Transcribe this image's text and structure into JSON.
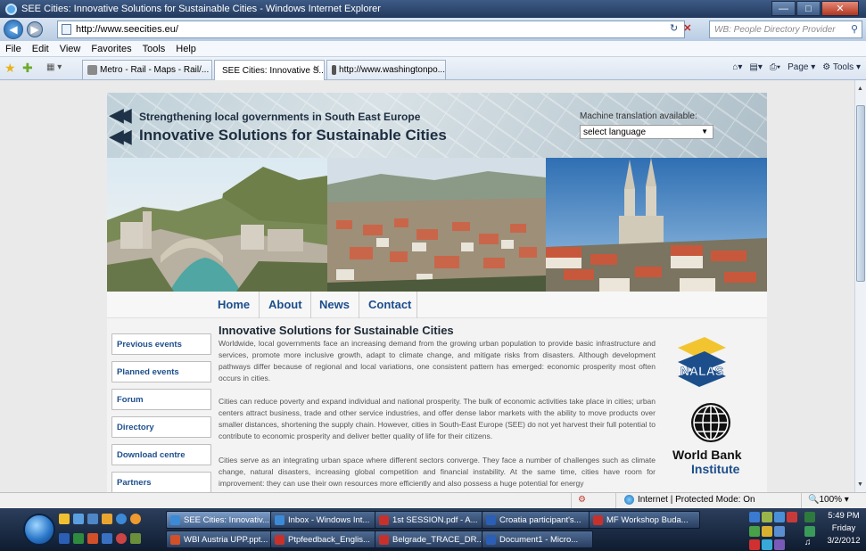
{
  "window": {
    "title": "SEE Cities: Innovative Solutions for Sustainable Cities - Windows Internet Explorer",
    "controls": [
      "minimize",
      "maximize",
      "close"
    ]
  },
  "address_bar": {
    "url": "http://www.seecities.eu/",
    "search_placeholder": "WB: People Directory Provider"
  },
  "menu": [
    "File",
    "Edit",
    "View",
    "Favorites",
    "Tools",
    "Help"
  ],
  "tabs": [
    {
      "label": "Metro - Rail - Maps - Rail/...",
      "icon": "metro-icon",
      "color": "#8a8a8a"
    },
    {
      "label": "SEE Cities: Innovative S...",
      "icon": "ie-icon",
      "color": "#3c8ad6",
      "active": true
    },
    {
      "label": "http://www.washingtonpo...",
      "icon": "washington-post-icon",
      "color": "#555555"
    }
  ],
  "command_bar": [
    "Page",
    "Tools"
  ],
  "site": {
    "banner_line1": "Strengthening local governments in South East Europe",
    "banner_line2": "Innovative Solutions for Sustainable Cities",
    "translation_label": "Machine translation available:",
    "language_select": "select language",
    "nav": [
      "Home",
      "About",
      "News",
      "Contact"
    ],
    "sidebar": [
      "Previous events",
      "Planned events",
      "Forum",
      "Directory",
      "Download centre",
      "Partners"
    ],
    "content_title": "Innovative Solutions for Sustainable Cities",
    "paragraphs": [
      "Worldwide, local governments face an increasing demand from the growing urban population to provide basic infrastructure and services, promote more inclusive growth, adapt to climate change, and mitigate risks from disasters. Although development pathways differ because of regional and local variations, one consistent pattern has emerged: economic prosperity most often occurs in cities.",
      "Cities can reduce poverty and expand individual and national prosperity. The bulk of economic activities take place in cities; urban centers attract business, trade and other service industries, and offer dense labor markets with the ability to move products over smaller distances, shortening the supply chain. However, cities in South-East Europe (SEE) do not yet harvest their full potential to contribute to economic prosperity and deliver better quality of life for their citizens.",
      "Cities serve as an integrating urban space where different sectors converge. They face a number of challenges such as climate change, natural disasters, increasing global competition and financial instability. At the same time, cities have room for improvement: they can use their own resources more efficiently and also possess a huge potential for energy"
    ],
    "partner_logos": {
      "nalas": "NALAS",
      "world_bank_line1": "World Bank",
      "world_bank_line2": "Institute"
    }
  },
  "status_bar": {
    "zone": "Internet | Protected Mode: On",
    "zoom": "100%"
  },
  "taskbar": {
    "row1": [
      {
        "label": "SEE Cities: Innovativ...",
        "color": "#3c8ad6",
        "active": true
      },
      {
        "label": "Inbox - Windows Int...",
        "color": "#3c8ad6"
      },
      {
        "label": "1st SESSION.pdf - A...",
        "color": "#c8312b"
      },
      {
        "label": "Croatia participant's...",
        "color": "#2b5fb5"
      },
      {
        "label": "MF Workshop Buda...",
        "color": "#c8312b"
      }
    ],
    "row2": [
      {
        "label": "WBI Austria UPP.ppt...",
        "color": "#d1502a"
      },
      {
        "label": "Ptpfeedback_Englis...",
        "color": "#c8312b"
      },
      {
        "label": "Belgrade_TRACE_DR...",
        "color": "#c8312b"
      },
      {
        "label": "Document1 - Micro...",
        "color": "#2b5fb5"
      }
    ],
    "clock_time": "5:49 PM",
    "clock_day": "Friday",
    "clock_date": "3/2/2012"
  }
}
